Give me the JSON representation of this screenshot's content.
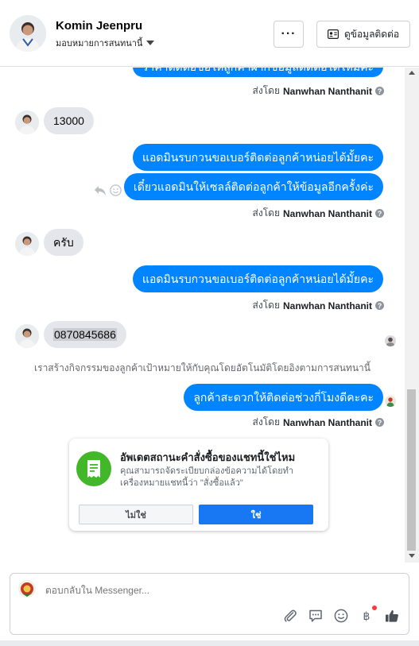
{
  "header": {
    "contact_name": "Komin Jeenpru",
    "assign_label": "มอบหมายการสนทนานี้",
    "more_label": "···",
    "contact_info_label": "ดูข้อมูลติดต่อ"
  },
  "thread": {
    "top_partial_bubble": "ราคาติดต่อขอให้ลูกค้าฝากข้อมูลติดต่อได้ไหมคะ",
    "sent_by_prefix": "ส่งโดย",
    "sender_name": "Nanwhan Nanthanit",
    "messages": [
      {
        "side": "in",
        "text": "13000"
      },
      {
        "side": "out",
        "text": "แอดมินรบกวนขอเบอร์ติดต่อลูกค้าหน่อยได้มั้ยคะ"
      },
      {
        "side": "out",
        "text": "เดี๋ยวแอดมินให้เซลล์ติดต่อลูกค้าให้ข้อมูลอีกครั้งค่ะ"
      },
      {
        "side": "in",
        "text": "ครับ"
      },
      {
        "side": "out",
        "text": "แอดมินรบกวนขอเบอร์ติดต่อลูกค้าหน่อยได้มั้ยคะ"
      },
      {
        "side": "in",
        "text": "0870845686"
      },
      {
        "side": "out",
        "text": "ลูกค้าสะดวกให้ติดต่อช่วงกี่โมงดีคะคะ"
      }
    ],
    "system_note": "เราสร้างกิจกรรมของลูกค้าเป้าหมายให้กับคุณโดยอัตโนมัติโดยอิงตามการสนทนานี้"
  },
  "status_card": {
    "title": "อัพเดตสถานะคำสั่งซื้อของแชทนี้ใช่ไหม",
    "description": "คุณสามารถจัดระเบียบกล่องข้อความได้โดยทำเครื่องหมายแชทนี้ว่า \"สั่งซื้อแล้ว\"",
    "no_label": "ไม่ใช่",
    "yes_label": "ใช่"
  },
  "composer": {
    "placeholder": "ตอบกลับใน Messenger...",
    "tools": [
      "attachment-icon",
      "saved-replies-icon",
      "emoji-icon",
      "baht-payment-icon",
      "like-icon"
    ]
  },
  "colors": {
    "accent": "#0084ff",
    "button_blue": "#1877f2",
    "status_green": "#42b72a",
    "incoming_bubble": "#e4e6eb"
  }
}
